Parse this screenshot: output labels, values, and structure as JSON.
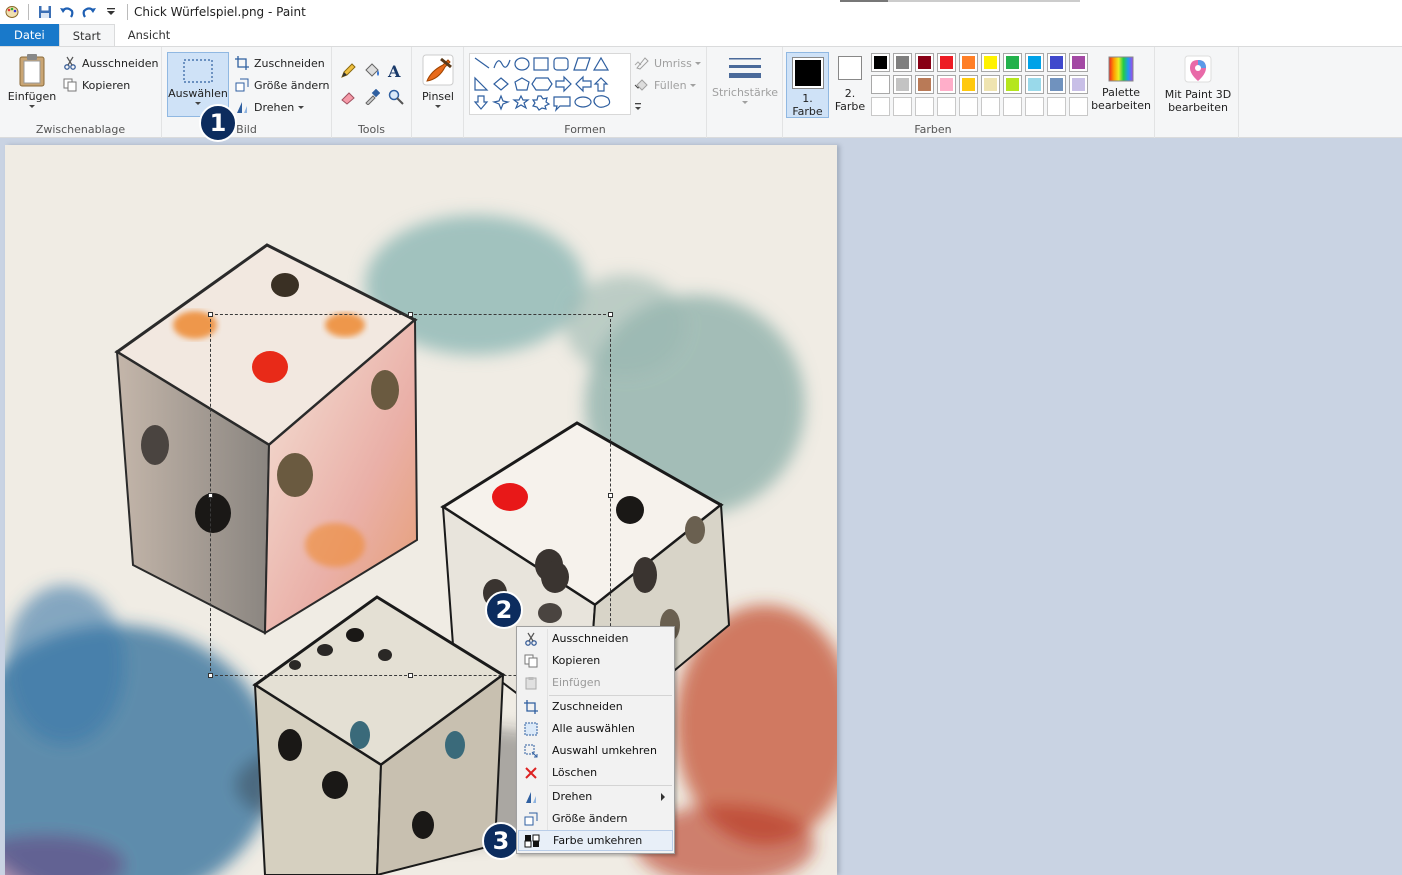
{
  "window": {
    "title": "Chick Würfelspiel.png - Paint"
  },
  "tabs": [
    {
      "label": "Datei"
    },
    {
      "label": "Start"
    },
    {
      "label": "Ansicht"
    }
  ],
  "clipboard": {
    "paste": "Einfügen",
    "cut": "Ausschneiden",
    "copy": "Kopieren",
    "group": "Zwischenablage"
  },
  "image": {
    "select": "Auswählen",
    "crop": "Zuschneiden",
    "resize": "Größe ändern",
    "rotate": "Drehen",
    "group": "Bild"
  },
  "tools": {
    "group": "Tools"
  },
  "brushes": {
    "label": "Pinsel"
  },
  "shapes": {
    "outline": "Umriss",
    "fill": "Füllen",
    "group": "Formen"
  },
  "stroke": {
    "label": "Strichstärke"
  },
  "colors": {
    "color1_num": "1.",
    "color1_label": "Farbe",
    "color2_num": "2.",
    "color2_label": "Farbe",
    "group": "Farben",
    "edit_palette_1": "Palette",
    "edit_palette_2": "bearbeiten",
    "paint3d_1": "Mit Paint 3D",
    "paint3d_2": "bearbeiten",
    "color1": "#000000",
    "color2": "#ffffff",
    "palette_row1": [
      "#000000",
      "#7f7f7f",
      "#880015",
      "#ed1c24",
      "#ff7f27",
      "#fff200",
      "#22b14c",
      "#00a2e8",
      "#3f48cc",
      "#a349a4"
    ],
    "palette_row2": [
      "#ffffff",
      "#c3c3c3",
      "#b97a57",
      "#ffaec9",
      "#ffc90e",
      "#efe4b0",
      "#b5e61d",
      "#99d9ea",
      "#7092be",
      "#c8bfe7"
    ]
  },
  "steps": [
    "1",
    "2",
    "3"
  ],
  "context_menu": {
    "items": [
      {
        "label": "Ausschneiden",
        "icon": "scissors-icon"
      },
      {
        "label": "Kopieren",
        "icon": "copy-icon"
      },
      {
        "label": "Einfügen",
        "icon": "clipboard-icon",
        "disabled": true
      },
      {
        "label": "Zuschneiden",
        "icon": "crop-icon"
      },
      {
        "label": "Alle auswählen",
        "icon": "select-all-icon"
      },
      {
        "label": "Auswahl umkehren",
        "icon": "invert-selection-icon"
      },
      {
        "label": "Löschen",
        "icon": "delete-x-icon"
      },
      {
        "label": "Drehen",
        "icon": "rotate-icon",
        "submenu": true
      },
      {
        "label": "Größe ändern",
        "icon": "resize-icon"
      },
      {
        "label": "Farbe umkehren",
        "icon": "invert-color-icon",
        "highlighted": true
      }
    ]
  }
}
